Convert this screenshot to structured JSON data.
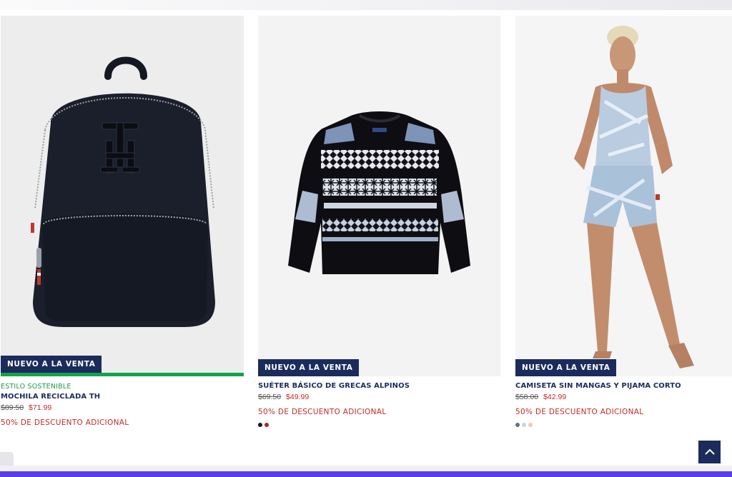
{
  "products": [
    {
      "badge": "NUEVO A LA VENTA",
      "eco_label": "ESTILO SOSTENIBLE",
      "name": "MOCHILA RECICLADA TH",
      "old_price": "$89.50",
      "new_price": "$71.99",
      "promo": "50% DE DESCUENTO ADICIONAL",
      "image_icon": "backpack-image",
      "swatches": []
    },
    {
      "badge": "NUEVO A LA VENTA",
      "name": "SUÉTER BÁSICO DE GRECAS ALPINOS",
      "old_price": "$69.50",
      "new_price": "$49.99",
      "promo": "50% DE DESCUENTO ADICIONAL",
      "image_icon": "sweater-image",
      "swatches": [
        "#1a1a1a",
        "#b3242b"
      ]
    },
    {
      "badge": "NUEVO A LA VENTA",
      "name": "CAMISETA SIN MANGAS Y PIJAMA CORTO",
      "old_price": "$58.00",
      "new_price": "$42.99",
      "promo": "50% DE DESCUENTO ADICIONAL",
      "image_icon": "pajama-model-image",
      "swatches": [
        "#5d7384",
        "#c8d3e2",
        "#f1c7b8"
      ]
    }
  ],
  "back_to_top_icon": "chevron-up-icon",
  "colors": {
    "navy": "#1b2c5c",
    "sale_red": "#c42a2a",
    "eco_green": "#14a24a",
    "bottom_bar": "#5b3ee6"
  }
}
